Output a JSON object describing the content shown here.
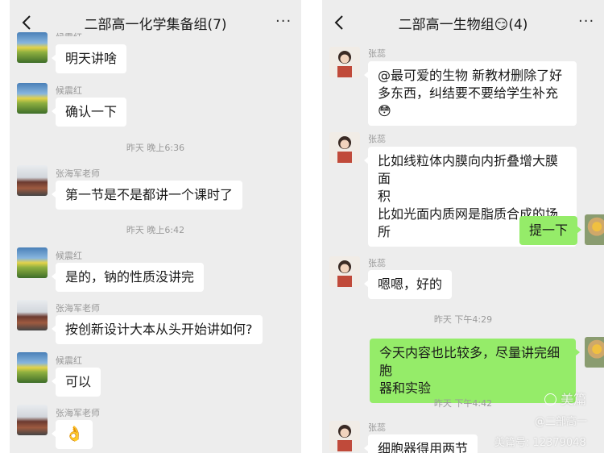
{
  "left_chat": {
    "title": "二部高一化学集备组(7)",
    "truncated_sender": "候震红",
    "messages": [
      {
        "text": "明天讲啥"
      },
      {
        "sender": "候震红",
        "text": "确认一下"
      },
      {
        "time": "昨天 晚上6:36"
      },
      {
        "sender": "张海军老师",
        "text": "第一节是不是都讲一个课时了"
      },
      {
        "time": "昨天 晚上6:42"
      },
      {
        "sender": "候震红",
        "text": "是的，钠的性质没讲完"
      },
      {
        "sender": "张海军老师",
        "text": "按创新设计大本从头开始讲如何?"
      },
      {
        "sender": "候震红",
        "text": "可以"
      },
      {
        "sender": "张海军老师",
        "text": "👌"
      }
    ]
  },
  "right_chat": {
    "title": "二部高一生物组😏(4)",
    "messages": [
      {
        "sender": "张蕊",
        "line1": "@最可爱的生物  新教材删除了好",
        "line2": "多东西，纠结要不要给学生补充",
        "line3": "😳"
      },
      {
        "sender": "张蕊",
        "line1": "比如线粒体内膜向内折叠增大膜面",
        "line2": "积",
        "line3": "比如光面内质网是脂质合成的场所"
      },
      {
        "text": "提一下"
      },
      {
        "sender": "张蕊",
        "text": "嗯嗯，好的"
      },
      {
        "time": "昨天 下午4:29"
      },
      {
        "line1": "今天内容也比较多，尽量讲完细胞",
        "line2": "器和实验"
      },
      {
        "time": "昨天 下午4:42"
      },
      {
        "sender": "张蕊",
        "text": "细胞器得用两节"
      }
    ]
  },
  "watermark": {
    "brand": "美篇",
    "handle": "@二部高一",
    "id": "美篇号: 12379048"
  },
  "icons": {
    "back": "chevron-left-icon",
    "more": "more-dots-icon"
  },
  "colors": {
    "bg": "#ededed",
    "bubble_self": "#95ec69",
    "bubble_other": "#ffffff"
  }
}
